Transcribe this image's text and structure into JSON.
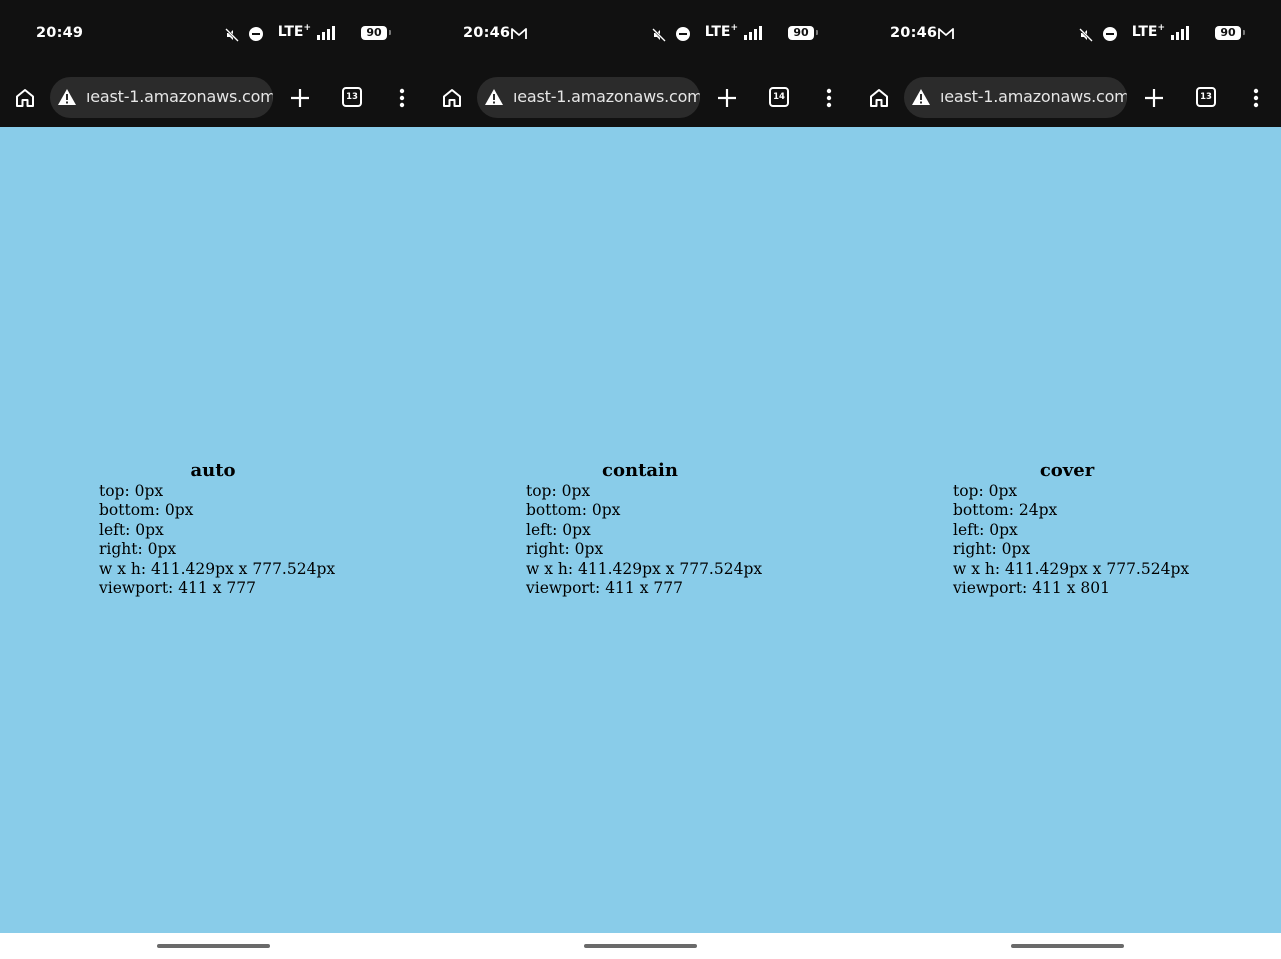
{
  "phones": [
    {
      "status": {
        "time": "20:49",
        "show_gmail": false,
        "network": "LTE",
        "battery": "90"
      },
      "toolbar": {
        "url": "ıeast-1.amazonaws.com",
        "tab_count": "13"
      },
      "content": {
        "title": "auto",
        "lines": [
          "top: 0px",
          "bottom: 0px",
          "left: 0px",
          "right: 0px",
          "w x h: 411.429px x 777.524px",
          "viewport: 411 x 777"
        ]
      }
    },
    {
      "status": {
        "time": "20:46",
        "show_gmail": true,
        "network": "LTE",
        "battery": "90"
      },
      "toolbar": {
        "url": "ıeast-1.amazonaws.com",
        "tab_count": "14"
      },
      "content": {
        "title": "contain",
        "lines": [
          "top: 0px",
          "bottom: 0px",
          "left: 0px",
          "right: 0px",
          "w x h: 411.429px x 777.524px",
          "viewport: 411 x 777"
        ]
      }
    },
    {
      "status": {
        "time": "20:46",
        "show_gmail": true,
        "network": "LTE",
        "battery": "90"
      },
      "toolbar": {
        "url": "ıeast-1.amazonaws.com",
        "tab_count": "13"
      },
      "content": {
        "title": "cover",
        "lines": [
          "top: 0px",
          "bottom: 24px",
          "left: 0px",
          "right: 0px",
          "w x h: 411.429px x 777.524px",
          "viewport: 411 x 801"
        ]
      }
    }
  ],
  "colors": {
    "chrome_bar": "#111111",
    "url_pill": "#2b2b2b",
    "page_background": "#89cce9",
    "gesture_pill": "#6a6a6a"
  },
  "icons": [
    "home-icon",
    "warning-icon",
    "plus-icon",
    "tab-switcher-icon",
    "more-vert-icon",
    "gmail-icon",
    "mute-icon",
    "dnd-icon",
    "signal-icon",
    "battery-icon"
  ]
}
